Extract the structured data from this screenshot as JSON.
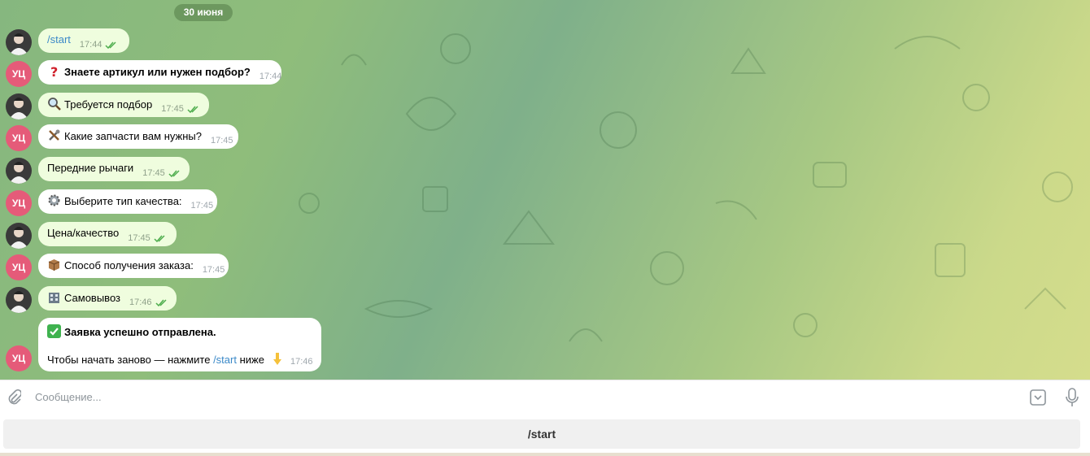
{
  "date_label": "30 июня",
  "bot_initials": "УЦ",
  "messages": [
    {
      "from": "user",
      "text": "/start",
      "time": "17:44"
    },
    {
      "from": "bot",
      "icon": "question-mark",
      "text": "Знаете артикул или нужен подбор?",
      "time": "17:44"
    },
    {
      "from": "user",
      "icon": "magnifier",
      "text": "Требуется подбор",
      "time": "17:45"
    },
    {
      "from": "bot",
      "icon": "tools",
      "text": "Какие запчасти вам нужны?",
      "time": "17:45"
    },
    {
      "from": "user",
      "text": "Передние рычаги",
      "time": "17:45"
    },
    {
      "from": "bot",
      "icon": "gear",
      "text": "Выберите тип качества:",
      "time": "17:45"
    },
    {
      "from": "user",
      "text": "Цена/качество",
      "time": "17:45"
    },
    {
      "from": "bot",
      "icon": "package",
      "text": "Способ получения заказа:",
      "time": "17:45"
    },
    {
      "from": "user",
      "icon": "building",
      "text": "Самовывоз",
      "time": "17:46"
    }
  ],
  "final_message": {
    "icon": "check-mark",
    "title": "Заявка успешно отправлена.",
    "line_prefix": "Чтобы начать заново — нажмите ",
    "line_command": "/start",
    "line_suffix": " ниже",
    "line_icon": "pointing-down",
    "time": "17:46"
  },
  "composer": {
    "placeholder": "Сообщение..."
  },
  "keyboard": {
    "button_label": "/start"
  },
  "colors": {
    "outgoing_bubble": "#effdde",
    "incoming_bubble": "#ffffff",
    "bot_avatar": "#e55b79",
    "link": "#3b89c8",
    "ticks": "#4fae4e"
  }
}
